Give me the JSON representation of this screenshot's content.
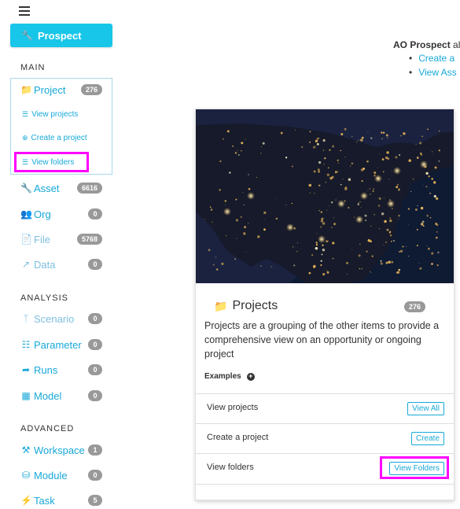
{
  "brand": {
    "label": "Prospect"
  },
  "sidebar": {
    "sections": {
      "main": "MAIN",
      "analysis": "ANALYSIS",
      "advanced": "ADVANCED"
    },
    "project": {
      "label": "Project",
      "count": "276",
      "sub_items": [
        {
          "label": "View projects"
        },
        {
          "label": "Create a project"
        },
        {
          "label": "View folders"
        }
      ]
    },
    "main_items": [
      {
        "label": "Asset",
        "count": "6616"
      },
      {
        "label": "Org",
        "count": "0"
      },
      {
        "label": "File",
        "count": "5768"
      },
      {
        "label": "Data",
        "count": "0"
      }
    ],
    "analysis_items": [
      {
        "label": "Scenario",
        "count": "0"
      },
      {
        "label": "Parameter",
        "count": "0"
      },
      {
        "label": "Runs",
        "count": "0"
      },
      {
        "label": "Model",
        "count": "0"
      }
    ],
    "advanced_items": [
      {
        "label": "Workspace",
        "count": "1"
      },
      {
        "label": "Module",
        "count": "0"
      },
      {
        "label": "Task",
        "count": "5"
      }
    ]
  },
  "intro": {
    "strong": "AO Prospect",
    "rest": " al",
    "links": [
      "Create a",
      "View Ass"
    ]
  },
  "card": {
    "title": "Projects",
    "count": "276",
    "description": "Projects are a grouping of the other items to provide a comprehensive view on an opportunity or ongoing project",
    "examples_label": "Examples",
    "rows": [
      {
        "text": "View projects",
        "button": "View All"
      },
      {
        "text": "Create a project",
        "button": "Create"
      },
      {
        "text": "View folders",
        "button": "View Folders"
      }
    ]
  },
  "colors": {
    "accent": "#17c6e8",
    "link": "#17a8d8",
    "highlight": "#ff00ff",
    "badge": "#999999"
  }
}
